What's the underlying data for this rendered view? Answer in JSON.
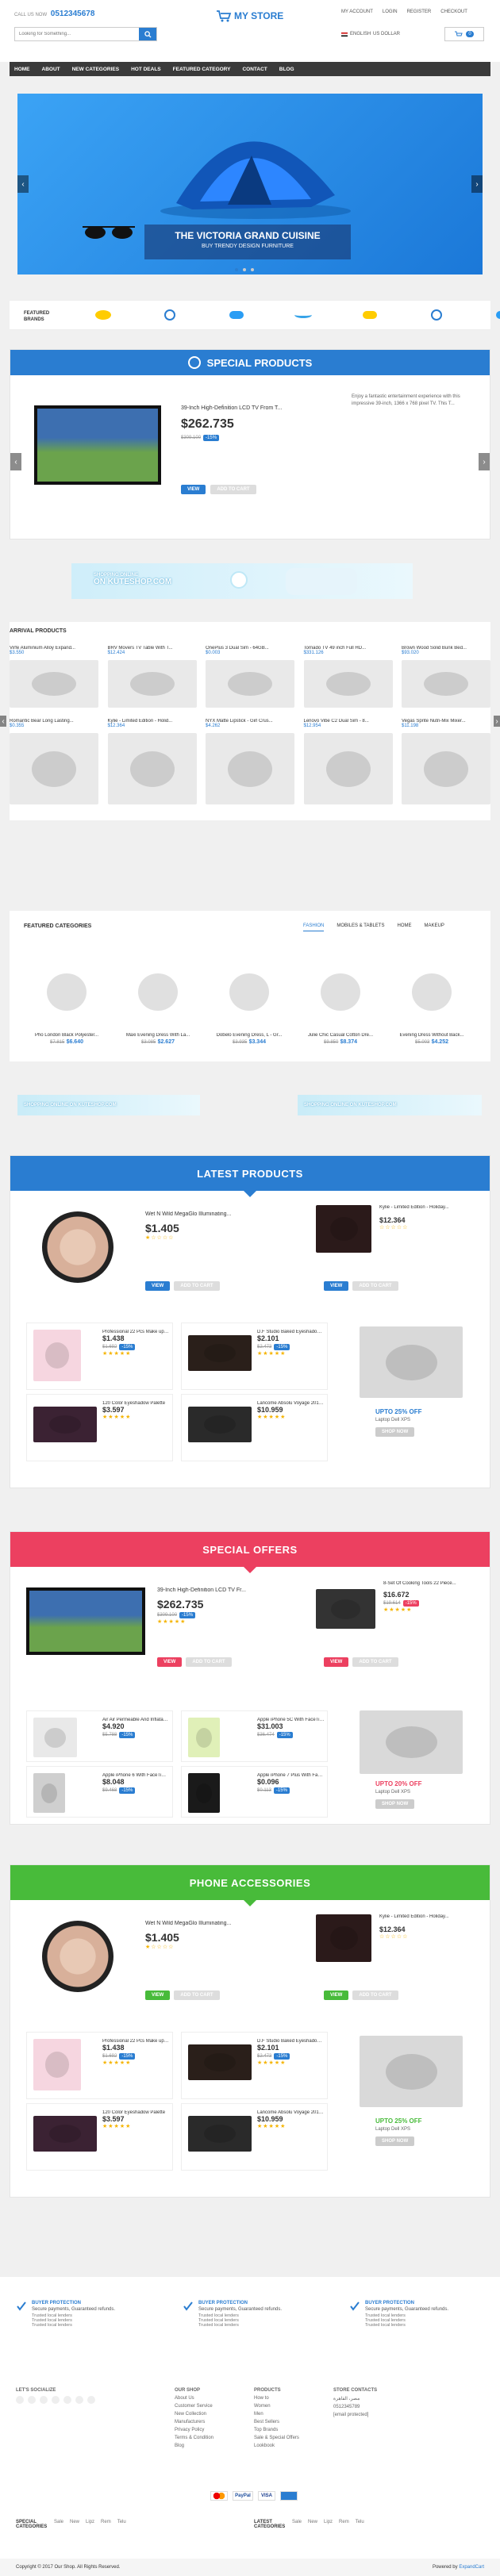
{
  "topbar": {
    "call_label": "CALL US NOW",
    "phone": "0512345678",
    "my_account": "MY ACCOUNT",
    "login": "LOGIN",
    "register": "REGISTER",
    "checkout": "CHECKOUT",
    "language": "ENGLISH",
    "currency": "US DOLLAR"
  },
  "search": {
    "placeholder": "Looking for Something..."
  },
  "brand": {
    "name": "MY STORE"
  },
  "cart": {
    "count": "0"
  },
  "nav": [
    "HOME",
    "ABOUT",
    "NEW CATEGORIES",
    "HOT DEALS",
    "FEATURED CATEGORY",
    "CONTACT",
    "BLOG"
  ],
  "hero": {
    "title": "THE VICTORIA GRAND CUISINE",
    "subtitle": "BUY TRENDY DESIGN FURNITURE"
  },
  "brands": {
    "label": "FEATURED BRANDS",
    "items": [
      "",
      "",
      "",
      "",
      "",
      "",
      ""
    ]
  },
  "special_products": {
    "title": "SPECIAL PRODUCTS",
    "name": "39-Inch High-Definition LCD TV From T...",
    "price": "$262.735",
    "old_price": "$309.100",
    "discount": "-15%",
    "description": "Enjoy a fantastic entertainment experience with this impressive 39-inch, 1366 x 768 pixel TV. This T...",
    "view": "VIEW",
    "add_to_cart": "ADD TO CART"
  },
  "promo1": {
    "line1": "SHOPPING ONLINE",
    "line2": "ON KUTESHOP.COM"
  },
  "arrivals": {
    "title": "ARRIVAL PRODUCTS",
    "row1": [
      {
        "name": "Virfe Aluminium Alloy Expand...",
        "price": "$3.550"
      },
      {
        "name": "BRV Movers TV Table With T...",
        "price": "$12.424"
      },
      {
        "name": "OnePlus 3 Dual Sim - 64GB...",
        "price": "$0.003"
      },
      {
        "name": "Tornado TV 49 inch Full HD...",
        "price": "$331.126"
      },
      {
        "name": "Brown Wood Solid Bunk Bed...",
        "price": "$93.020"
      }
    ],
    "row2": [
      {
        "name": "Romantic Bear Long Lasting...",
        "price": "$0.355"
      },
      {
        "name": "Kylie - Limited Edition - Holid...",
        "price": "$12.364"
      },
      {
        "name": "NYX Matte Lipstick - Girl Crus...",
        "price": "$4.262"
      },
      {
        "name": "Lenovo Vibe C2 Dual Sim - 8...",
        "price": "$12.954"
      },
      {
        "name": "Vegas Sprite Nutri-Mix Mixer...",
        "price": "$11.198"
      }
    ]
  },
  "featured": {
    "title": "FEATURED CATEGORIES",
    "tabs": [
      "FASHION",
      "MOBILES & TABLETS",
      "HOME",
      "MAKEUP"
    ],
    "items": [
      {
        "name": "Pho London Black Polyester...",
        "old": "$7.815",
        "price": "$6.640"
      },
      {
        "name": "Maxi Evening Dress With La...",
        "old": "$3.085",
        "price": "$2.627"
      },
      {
        "name": "Dobelo Evening Dress, L - Gr...",
        "old": "$3.935",
        "price": "$3.344"
      },
      {
        "name": "Julie Chic Casual Cotton Dre...",
        "old": "$9.850",
        "price": "$8.374"
      },
      {
        "name": "Evening Dress Without Back...",
        "old": "$5.003",
        "price": "$4.252"
      }
    ]
  },
  "promo2": {
    "a": "SHOPPING ONLINE ON KUTESHOP.COM",
    "b": "SHOPPING ONLINE ON KUTESHOP.COM"
  },
  "latest": {
    "title": "LATEST PRODUCTS",
    "main": {
      "name": "Wet N Wild MegaGlo Illuminating...",
      "price": "$1.405"
    },
    "side": {
      "name": "Kylie - Limited Edition - Holiday...",
      "price": "$12.364"
    },
    "g1": {
      "name": "Professional 22 Pcs Make up M...",
      "price": "$1.438",
      "old": "$1.692"
    },
    "g2": {
      "name": "D.F Studio Baked Eyeshadow ...",
      "price": "$2.101",
      "old": "$2.473"
    },
    "g3": {
      "name": "120 Color Eyeshadow Palette",
      "price": "$3.597"
    },
    "g4": {
      "name": "Lancome Absolu Voyage 2012 ...",
      "price": "$10.959"
    },
    "promo": {
      "title": "UPTO 25% OFF",
      "sub": "Laptop Dell XPS",
      "btn": "SHOP NOW"
    }
  },
  "offers": {
    "title": "SPECIAL OFFERS",
    "main": {
      "name": "39-Inch High-Definition LCD TV Fr...",
      "price": "$262.735",
      "old": "$309.100"
    },
    "side": {
      "name": "8-Set Of Cooking Tools 22 Piece...",
      "price": "$16.672",
      "old": "$19.614"
    },
    "g1": {
      "name": "Air Air Permeable And Inflatab...",
      "price": "$4.920",
      "old": "$5.788"
    },
    "g2": {
      "name": "Apple iPhone 5C With FaceTim...",
      "price": "$31.003",
      "old": "$36.474"
    },
    "g3": {
      "name": "Apple iPhone 6 With FaceTime...",
      "price": "$8.048",
      "old": "$9.468"
    },
    "g4": {
      "name": "Apple iPhone 7 Plus With Face...",
      "price": "$0.096",
      "old": "$0.113"
    },
    "promo": {
      "title": "UPTO 20% OFF",
      "sub": "Laptop Dell XPS",
      "btn": "SHOP NOW"
    }
  },
  "accessories": {
    "title": "PHONE ACCESSORIES",
    "main": {
      "name": "Wet N Wild MegaGlo Illuminating...",
      "price": "$1.405"
    },
    "side": {
      "name": "Kylie - Limited Edition - Holiday...",
      "price": "$12.364"
    },
    "g1": {
      "name": "Professional 22 Pcs Make up M...",
      "price": "$1.438",
      "old": "$1.692"
    },
    "g2": {
      "name": "D.F Studio Baked Eyeshadow ...",
      "price": "$2.101",
      "old": "$2.473"
    },
    "g3": {
      "name": "120 Color Eyeshadow Palette",
      "price": "$3.597"
    },
    "g4": {
      "name": "Lancome Absolu Voyage 2012 ...",
      "price": "$10.959"
    },
    "promo": {
      "title": "UPTO 25% OFF",
      "sub": "Laptop Dell XPS",
      "btn": "SHOP NOW"
    }
  },
  "protection": [
    {
      "title": "BUYER PROTECTION",
      "text": "Secure payments, Guaranteed refunds.",
      "l1": "Trusted local lenders",
      "l2": "Trusted local lenders",
      "l3": "Trusted local lenders"
    },
    {
      "title": "BUYER PROTECTION",
      "text": "Secure payments, Guaranteed refunds.",
      "l1": "Trusted local lenders",
      "l2": "Trusted local lenders",
      "l3": "Trusted local lenders"
    },
    {
      "title": "BUYER PROTECTION",
      "text": "Secure payments, Guaranteed refunds.",
      "l1": "Trusted local lenders",
      "l2": "Trusted local lenders",
      "l3": "Trusted local lenders"
    }
  ],
  "footer": {
    "social_title": "LET'S SOCIALIZE",
    "shop_title": "OUR SHOP",
    "shop_links": [
      "About Us",
      "Customer Service",
      "New Collection",
      "Manufacturers",
      "Privacy Policy",
      "Terms & Condition",
      "Blog"
    ],
    "products_title": "PRODUCTS",
    "product_links": [
      "How to",
      "Women",
      "Men",
      "Best Sellers",
      "Top Brands",
      "Sale & Special Offers",
      "Lookbook"
    ],
    "contact_title": "STORE CONTACTS",
    "contact_address": "مصر، القاهرة",
    "contact_phone": "0512345789",
    "contact_email": "[email protected]",
    "payments": [
      "",
      "PayPal",
      "VISA",
      ""
    ],
    "special_label": "SPECIAL CATEGORIES",
    "special_links": [
      "Sale",
      "New",
      "Lipz",
      "Rem",
      "Telu"
    ],
    "latest_label": "LATEST CATEGORIES",
    "latest_links": [
      "Sale",
      "New",
      "Lipz",
      "Rem",
      "Telu"
    ],
    "copyright": "Copyright © 2017 Our Shop. All Rights Reserved.",
    "powered": "Powered by",
    "powered_brand": "ExpandCart"
  },
  "colors": {
    "blue": "#2a7dd1",
    "red": "#ec4060",
    "green": "#48bb3a",
    "nav": "#333333"
  }
}
